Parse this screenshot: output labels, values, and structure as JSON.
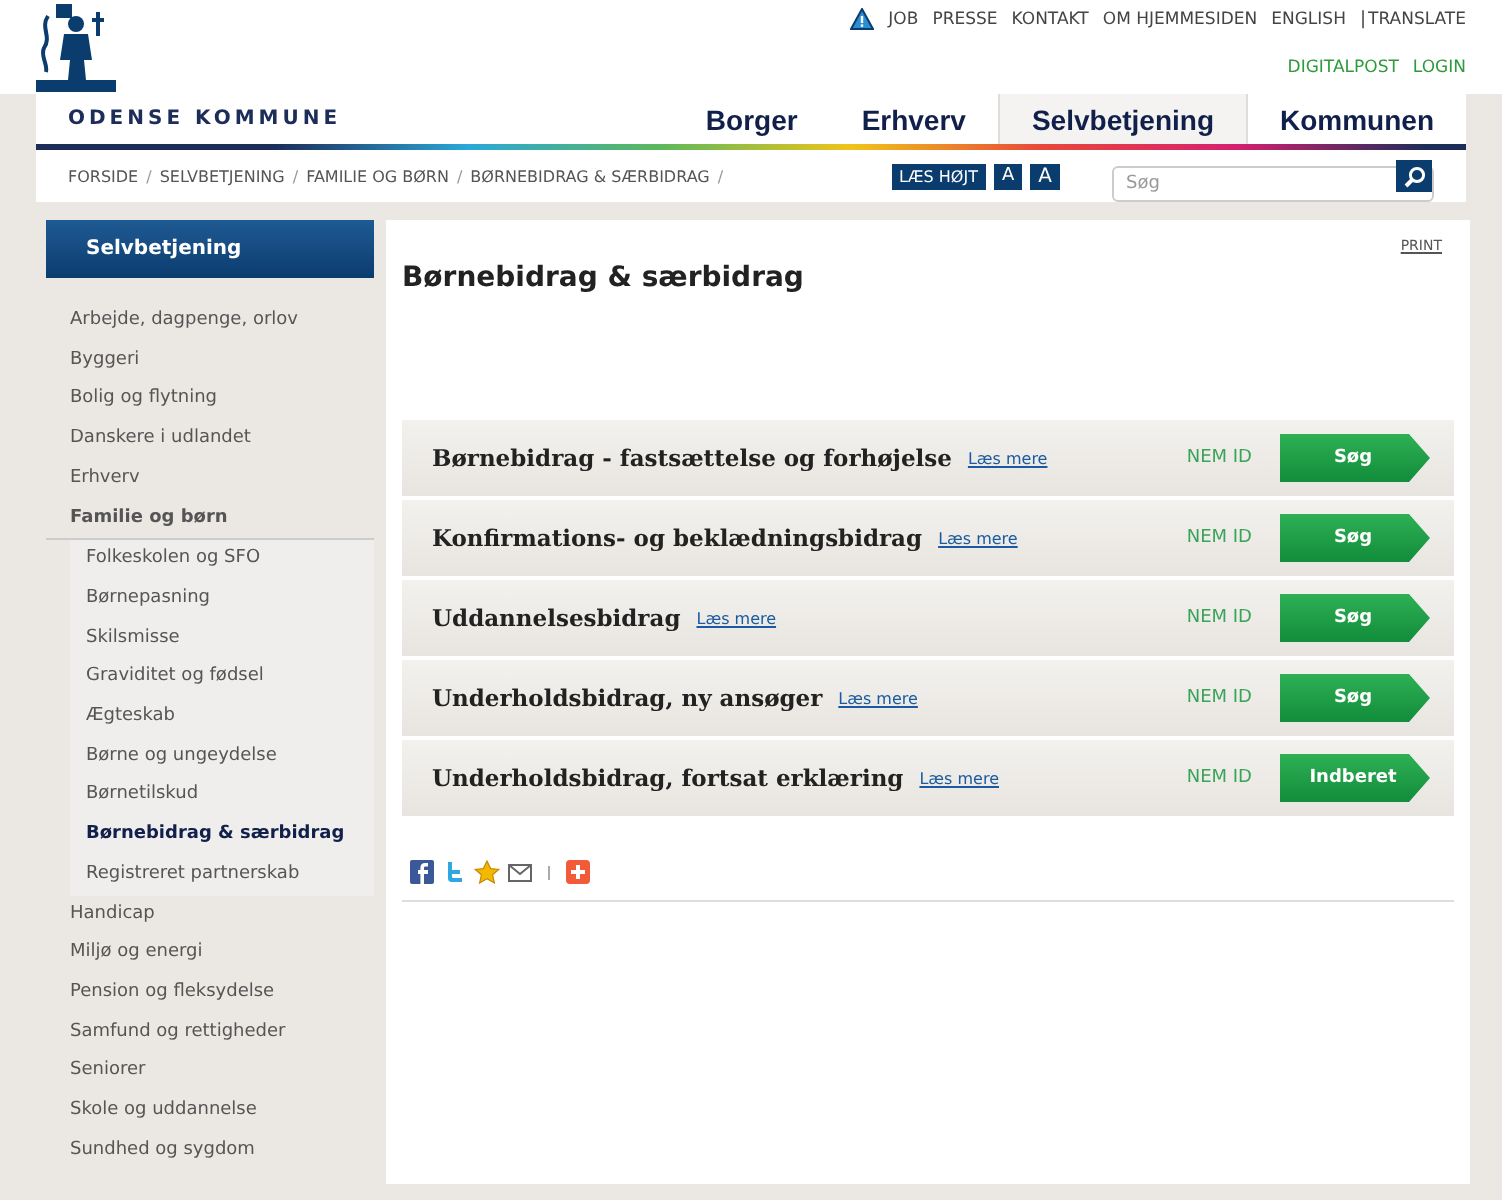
{
  "top_links": [
    "JOB",
    "PRESSE",
    "KONTAKT",
    "OM HJEMMESIDEN",
    "ENGLISH",
    "TRANSLATE"
  ],
  "account_links": [
    "DIGITALPOST",
    "LOGIN"
  ],
  "site_name": "ODENSE KOMMUNE",
  "tabs": [
    {
      "label": "Borger",
      "selected": false
    },
    {
      "label": "Erhverv",
      "selected": false
    },
    {
      "label": "Selvbetjening",
      "selected": true
    },
    {
      "label": "Kommunen",
      "selected": false
    }
  ],
  "link_separator": "|",
  "breadcrumb": [
    "FORSIDE",
    "SELVBETJENING",
    "FAMILIE OG BØRN",
    "BØRNEBIDRAG & SÆRBIDRAG"
  ],
  "breadcrumb_separator": "/",
  "tools": {
    "read_aloud": "LÆS HØJT",
    "font_buttons": [
      "A",
      "A"
    ]
  },
  "search": {
    "placeholder": "Søg"
  },
  "sidebar": {
    "title": "Selvbetjening",
    "items": [
      {
        "label": "Arbejde, dagpenge, orlov",
        "selected": false,
        "expanded": false
      },
      {
        "label": "Byggeri",
        "selected": false,
        "expanded": false
      },
      {
        "label": "Bolig og flytning",
        "selected": false,
        "expanded": false
      },
      {
        "label": "Danskere i udlandet",
        "selected": false,
        "expanded": false
      },
      {
        "label": "Erhverv",
        "selected": false,
        "expanded": false
      },
      {
        "label": "Familie og børn",
        "selected": false,
        "expanded": true,
        "children": [
          {
            "label": "Folkeskolen og SFO",
            "selected": false
          },
          {
            "label": "Børnepasning",
            "selected": false
          },
          {
            "label": "Skilsmisse",
            "selected": false
          },
          {
            "label": "Graviditet og fødsel",
            "selected": false
          },
          {
            "label": "Ægteskab",
            "selected": false
          },
          {
            "label": "Børne og ungeydelse",
            "selected": false
          },
          {
            "label": "Børnetilskud",
            "selected": false
          },
          {
            "label": "Børnebidrag & særbidrag",
            "selected": true
          },
          {
            "label": "Registreret partnerskab",
            "selected": false
          }
        ]
      },
      {
        "label": "Handicap",
        "selected": false,
        "expanded": false
      },
      {
        "label": "Miljø og energi",
        "selected": false,
        "expanded": false
      },
      {
        "label": "Pension og fleksydelse",
        "selected": false,
        "expanded": false
      },
      {
        "label": "Samfund og rettigheder",
        "selected": false,
        "expanded": false
      },
      {
        "label": "Seniorer",
        "selected": false,
        "expanded": false
      },
      {
        "label": "Skole og uddannelse",
        "selected": false,
        "expanded": false
      },
      {
        "label": "Sundhed og sygdom",
        "selected": false,
        "expanded": false
      }
    ]
  },
  "print_link": "PRINT",
  "page_title": "Børnebidrag & særbidrag",
  "services": [
    {
      "title": "Børnebidrag - fastsættelse og forhøjelse",
      "link": "Læs mere",
      "login": "NEM ID",
      "action": "Søg"
    },
    {
      "title": "Konfirmations- og beklædningsbidrag",
      "link": "Læs mere",
      "login": "NEM ID",
      "action": "Søg"
    },
    {
      "title": "Uddannelsesbidrag",
      "link": "Læs mere",
      "login": "NEM ID",
      "action": "Søg"
    },
    {
      "title": "Underholdsbidrag, ny ansøger",
      "link": "Læs mere",
      "login": "NEM ID",
      "action": "Søg"
    },
    {
      "title": "Underholdsbidrag, fortsat erklæring",
      "link": "Læs mere",
      "login": "NEM ID",
      "action": "Indberet"
    }
  ],
  "share_icons": [
    {
      "kind": "facebook"
    },
    {
      "kind": "twitter"
    },
    {
      "kind": "favorite"
    },
    {
      "kind": "email"
    },
    {
      "kind": "separator"
    },
    {
      "kind": "addthis"
    }
  ]
}
